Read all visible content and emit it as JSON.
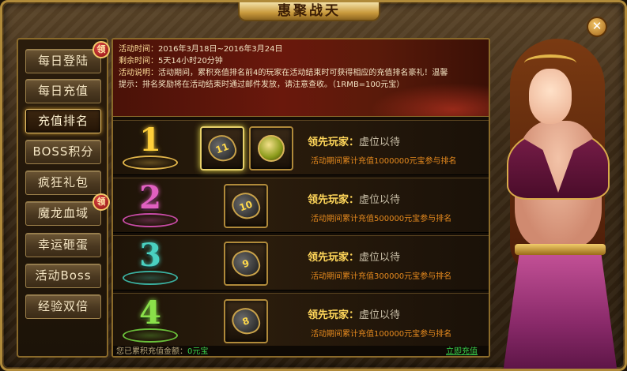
{
  "window": {
    "title": "惠聚战天",
    "close_label": "✕"
  },
  "sidebar": {
    "items": [
      {
        "label": "每日登陆",
        "active": false,
        "badge": "领"
      },
      {
        "label": "每日充值",
        "active": false,
        "badge": ""
      },
      {
        "label": "充值排名",
        "active": true,
        "badge": ""
      },
      {
        "label": "BOSS积分",
        "active": false,
        "badge": ""
      },
      {
        "label": "疯狂礼包",
        "active": false,
        "badge": ""
      },
      {
        "label": "魔龙血域",
        "active": false,
        "badge": "领"
      },
      {
        "label": "幸运砸蛋",
        "active": false,
        "badge": ""
      },
      {
        "label": "活动Boss",
        "active": false,
        "badge": ""
      },
      {
        "label": "经验双倍",
        "active": false,
        "badge": ""
      }
    ]
  },
  "info": {
    "time_label": "活动时间：",
    "time_value": "2016年3月18日~2016年3月24日",
    "remain_label": "剩余时间：",
    "remain_value": "5天14小时20分钟",
    "desc_label": "活动说明：",
    "desc_value": "活动期间，累积充值排名前4的玩家在活动结束时可获得相应的充值排名豪礼！温馨",
    "desc_value2": "提示：排名奖励将在活动结束时通过邮件发放，请注意查收。（1RMB=100元宝）"
  },
  "ranks": [
    {
      "rank": "1",
      "color": "#ffcf3a",
      "pedestal": "#e0b44a",
      "items": [
        {
          "type": "gem",
          "num": "11",
          "glow": true
        },
        {
          "type": "orb",
          "num": "",
          "glow": false
        }
      ],
      "leader_label": "领先玩家：",
      "leader_value": "虚位以待",
      "requirement": "活动期间累计充值1000000元宝参与排名"
    },
    {
      "rank": "2",
      "color": "#e060c0",
      "pedestal": "#c84ba6",
      "items": [
        {
          "type": "gem",
          "num": "10",
          "glow": false
        }
      ],
      "leader_label": "领先玩家：",
      "leader_value": "虚位以待",
      "requirement": "活动期间累计充值500000元宝参与排名"
    },
    {
      "rank": "3",
      "color": "#4ad0c0",
      "pedestal": "#3ab0a0",
      "items": [
        {
          "type": "gem",
          "num": "9",
          "glow": false
        }
      ],
      "leader_label": "领先玩家：",
      "leader_value": "虚位以待",
      "requirement": "活动期间累计充值300000元宝参与排名"
    },
    {
      "rank": "4",
      "color": "#8ae04a",
      "pedestal": "#6ac03a",
      "items": [
        {
          "type": "gem",
          "num": "8",
          "glow": false
        }
      ],
      "leader_label": "领先玩家：",
      "leader_value": "虚位以待",
      "requirement": "活动期间累计充值100000元宝参与排名"
    }
  ],
  "footer": {
    "total_label": "您已累积充值金额：",
    "total_value": "0元宝",
    "recharge_label": "立即充值"
  }
}
